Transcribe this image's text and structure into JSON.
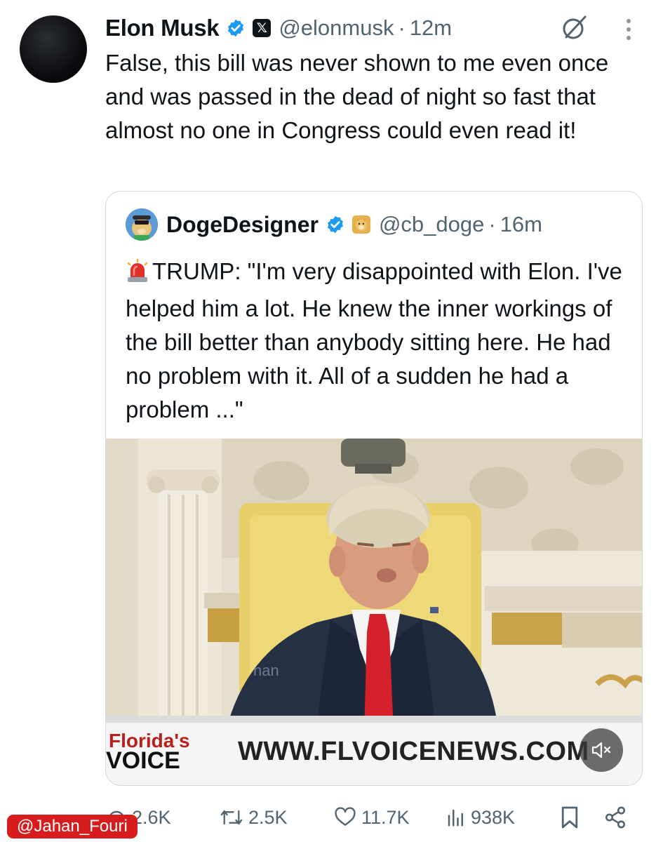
{
  "tweet": {
    "author_name": "Elon Musk",
    "handle": "@elonmusk",
    "separator": "·",
    "time": "12m",
    "text": "False, this bill was never shown to me even once and was passed in the dead of night so fast that almost no one in Congress could even read it!"
  },
  "quote": {
    "author_name": "DogeDesigner",
    "handle": "@cb_doge",
    "separator": "·",
    "time": "16m",
    "text": "TRUMP: \"I'm very disappointed with Elon. I've helped him a lot. He knew the inner workings of the bill better than anybody sitting here. He had no problem with it. All of a sudden he had a problem ...\"",
    "media": {
      "banner_brand_line1": "Florida's",
      "banner_brand_line2": "VOICE",
      "banner_url": "WWW.FLVOICENEWS.COM",
      "overlay_text": "nan"
    }
  },
  "actions": {
    "replies": "2.6K",
    "reposts": "2.5K",
    "likes": "11.7K",
    "views": "938K"
  },
  "watermark": "@Jahan_Fouri",
  "colors": {
    "verified": "#1d9bf0",
    "text_primary": "#0f1419",
    "text_secondary": "#536471",
    "border": "#cfd9de",
    "watermark_bg": "#d61c1c"
  }
}
